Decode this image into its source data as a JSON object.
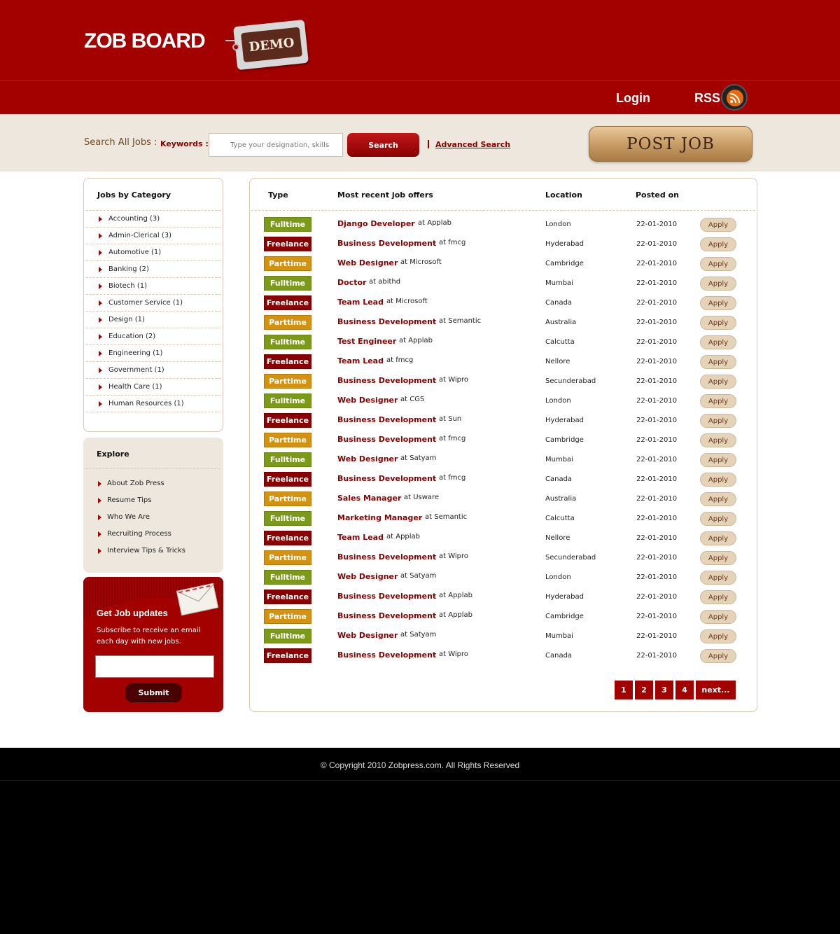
{
  "header": {
    "logo_text": "ZOB BOARD",
    "logo_tag": "DEMO",
    "login": "Login",
    "rss": "RSS"
  },
  "search": {
    "label": "Search All Jobs :",
    "keywords_label": "Keywords :",
    "placeholder": "Type your designation, skills",
    "button": "Search",
    "advanced": "Advanced Search",
    "post_job": "POST JOB"
  },
  "categories": {
    "title": "Jobs by Category",
    "items": [
      "Accounting (3)",
      "Admin-Clerical (3)",
      "Automotive (1)",
      "Banking (2)",
      "Biotech (1)",
      "Customer Service (1)",
      "Design (1)",
      "Education (2)",
      "Engineering (1)",
      "Government (1)",
      "Health Care (1)",
      "Human Resources (1)"
    ]
  },
  "explore": {
    "title": "Explore",
    "items": [
      "About Zob Press",
      "Resume Tips",
      "Who We Are",
      "Recruiting Process",
      "Interview Tips & Tricks"
    ]
  },
  "updates": {
    "title": "Get Job updates",
    "text": "Subscribe to receive an email each day with new jobs.",
    "submit": "Submit"
  },
  "jobs": {
    "headers": {
      "type": "Type",
      "offers": "Most recent job offers",
      "location": "Location",
      "posted": "Posted on"
    },
    "apply_label": "Apply",
    "rows": [
      {
        "type": "Fulltime",
        "kind": "fulltime",
        "title": "Django Developer",
        "company": "at Applab",
        "location": "London",
        "date": "22-01-2010"
      },
      {
        "type": "Freelance",
        "kind": "freelance",
        "title": "Business Development",
        "company": "at fmcg",
        "location": "Hyderabad",
        "date": "22-01-2010"
      },
      {
        "type": "Parttime",
        "kind": "parttime",
        "title": "Web Designer",
        "company": "at Microsoft",
        "location": "Cambridge",
        "date": "22-01-2010"
      },
      {
        "type": "Fulltime",
        "kind": "fulltime",
        "title": "Doctor",
        "company": "at abithd",
        "location": "Mumbai",
        "date": "22-01-2010"
      },
      {
        "type": "Freelance",
        "kind": "freelance",
        "title": "Team Lead",
        "company": "at Microsoft",
        "location": "Canada",
        "date": "22-01-2010"
      },
      {
        "type": "Parttime",
        "kind": "parttime",
        "title": "Business Development",
        "company": "at Semantic",
        "location": "Australia",
        "date": "22-01-2010"
      },
      {
        "type": "Fulltime",
        "kind": "fulltime",
        "title": "Test Engineer",
        "company": " at Applab",
        "location": "Calcutta",
        "date": "22-01-2010"
      },
      {
        "type": "Freelance",
        "kind": "freelance",
        "title": "Team Lead",
        "company": "at fmcg",
        "location": "Nellore",
        "date": "22-01-2010"
      },
      {
        "type": "Parttime",
        "kind": "parttime",
        "title": "Business Development",
        "company": "at Wipro",
        "location": "Secunderabad",
        "date": "22-01-2010"
      },
      {
        "type": "Fulltime",
        "kind": "fulltime",
        "title": "Web Designer",
        "company": "at CGS",
        "location": "London",
        "date": "22-01-2010"
      },
      {
        "type": "Freelance",
        "kind": "freelance",
        "title": "Business Development",
        "company": "at Sun",
        "location": "Hyderabad",
        "date": "22-01-2010"
      },
      {
        "type": "Parttime",
        "kind": "parttime",
        "title": "Business Development",
        "company": "at fmcg",
        "location": "Cambridge",
        "date": "22-01-2010"
      },
      {
        "type": "Fulltime",
        "kind": "fulltime",
        "title": "Web Designer",
        "company": "at Satyam",
        "location": "Mumbai",
        "date": "22-01-2010"
      },
      {
        "type": "Freelance",
        "kind": "freelance",
        "title": "Business Development",
        "company": "at fmcg",
        "location": "Canada",
        "date": "22-01-2010"
      },
      {
        "type": "Parttime",
        "kind": "parttime",
        "title": "Sales Manager",
        "company": "at Usware",
        "location": "Australia",
        "date": "22-01-2010"
      },
      {
        "type": "Fulltime",
        "kind": "fulltime",
        "title": "Marketing Manager",
        "company": "at Semantic",
        "location": "Calcutta",
        "date": "22-01-2010"
      },
      {
        "type": "Freelance",
        "kind": "freelance",
        "title": "Team Lead",
        "company": "at Applab",
        "location": "Nellore",
        "date": "22-01-2010"
      },
      {
        "type": "Parttime",
        "kind": "parttime",
        "title": "Business Development",
        "company": "at Wipro",
        "location": "Secunderabad",
        "date": "22-01-2010"
      },
      {
        "type": "Fulltime",
        "kind": "fulltime",
        "title": "Web Designer",
        "company": "at Satyam",
        "location": "London",
        "date": "22-01-2010"
      },
      {
        "type": "Freelance",
        "kind": "freelance",
        "title": "Business Development",
        "company": "at Applab",
        "location": "Hyderabad",
        "date": "22-01-2010"
      },
      {
        "type": "Parttime",
        "kind": "parttime",
        "title": "Business Development",
        "company": "at Applab",
        "location": "Cambridge",
        "date": "22-01-2010"
      },
      {
        "type": "Fulltime",
        "kind": "fulltime",
        "title": "Web Designer",
        "company": "at Satyam",
        "location": "Mumbai",
        "date": "22-01-2010"
      },
      {
        "type": "Freelance",
        "kind": "freelance",
        "title": "Business Development",
        "company": "at Wipro",
        "location": "Canada",
        "date": "22-01-2010"
      }
    ]
  },
  "pagination": [
    "1",
    "2",
    "3",
    "4",
    "next..."
  ],
  "footer": {
    "copyright": "© Copyright 2010 Zobpress.com. All Rights Reserved"
  },
  "colors": {
    "brand_red": "#a30000",
    "fulltime": "#7a9a18",
    "freelance": "#8b0000",
    "parttime": "#d4920f",
    "beige": "#eee7dd"
  },
  "icons": [
    "rss-icon",
    "arrow-icon",
    "envelope-icon"
  ]
}
